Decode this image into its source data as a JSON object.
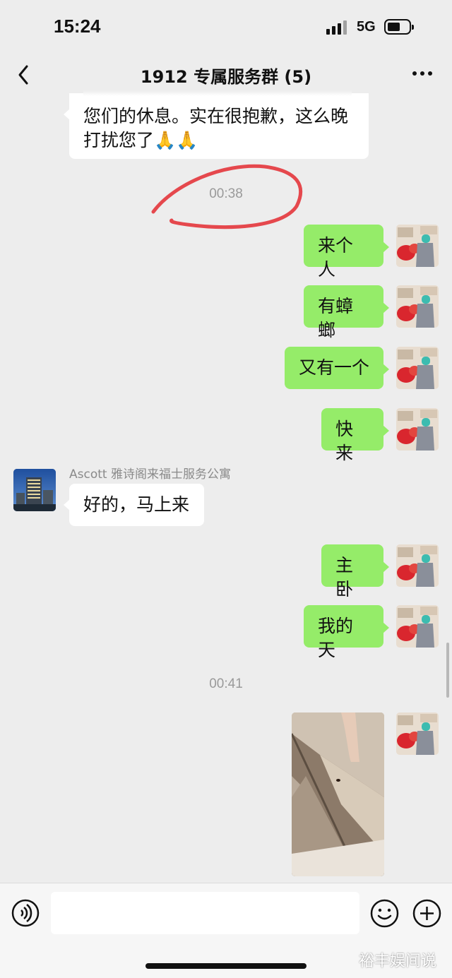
{
  "status_bar": {
    "time": "15:24",
    "network": "5G"
  },
  "nav": {
    "title": "1912 专属服务群 (5)"
  },
  "messages": {
    "partial_line1": "您们的休息。实在很抱歉，这么晚",
    "partial_line2": "打扰您了",
    "partial_emoji": "🙏🙏",
    "ts1": "00:38",
    "m1": "来个人",
    "m2": "有蟑螂",
    "m3": "又有一个",
    "m4": "快来",
    "sender_name": "Ascott 雅诗阁来福士服务公寓",
    "reply": "好的，马上来",
    "m5": "主卧",
    "m6": "我的天",
    "ts2": "00:41"
  },
  "input": {
    "value": "",
    "placeholder": ""
  },
  "watermark": "裕丰娱间说",
  "colors": {
    "background": "#ededed",
    "outgoing_bubble": "#95ec69",
    "incoming_bubble": "#ffffff",
    "annotation_circle": "#e5484d"
  },
  "icons": [
    "back-chevron-icon",
    "more-dots-icon",
    "voice-icon",
    "emoji-icon",
    "plus-icon",
    "signal-icon",
    "battery-icon"
  ]
}
